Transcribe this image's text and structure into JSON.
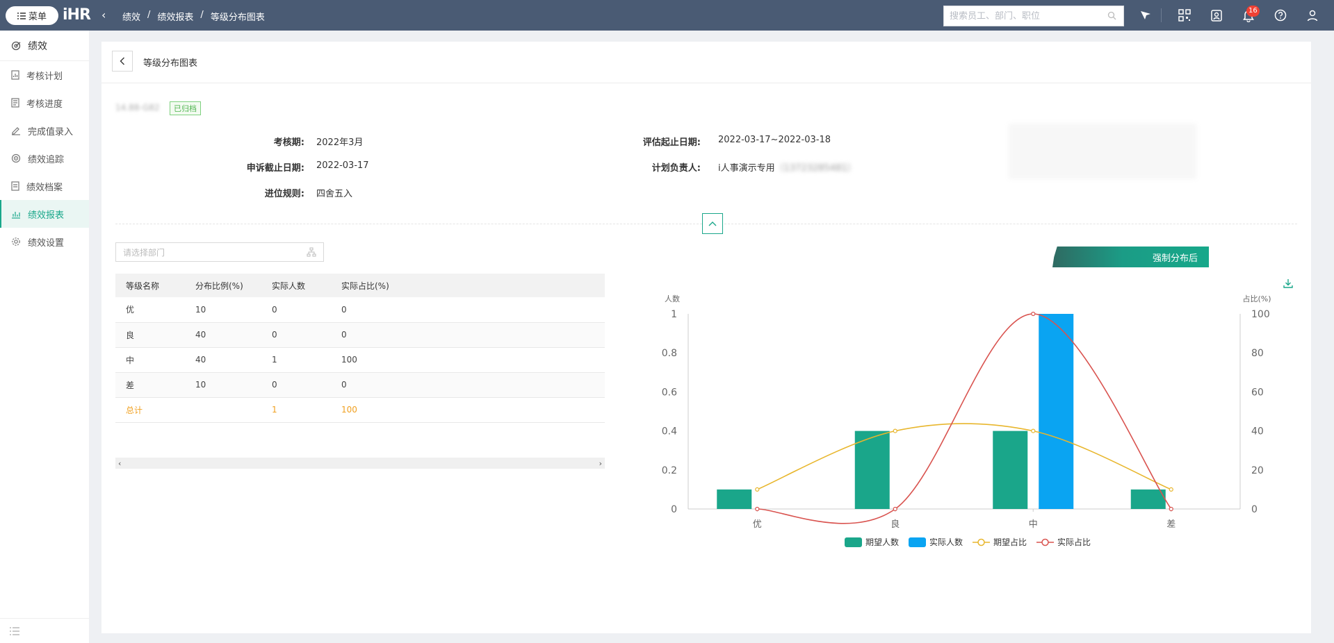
{
  "topbar": {
    "menu_label": "菜单",
    "logo_text": "iHR",
    "breadcrumb": [
      "绩效",
      "/",
      "绩效报表",
      "/",
      "等级分布图表"
    ],
    "search_placeholder": "搜索员工、部门、职位",
    "notification_count": "16"
  },
  "sidebar": {
    "title": "绩效",
    "items": [
      {
        "label": "考核计划",
        "icon": "doc-icon"
      },
      {
        "label": "考核进度",
        "icon": "progress-icon"
      },
      {
        "label": "完成值录入",
        "icon": "pen-icon"
      },
      {
        "label": "绩效追踪",
        "icon": "target-icon"
      },
      {
        "label": "绩效档案",
        "icon": "archive-icon"
      },
      {
        "label": "绩效报表",
        "icon": "chart-icon",
        "active": true
      },
      {
        "label": "绩效设置",
        "icon": "gear-icon"
      }
    ]
  },
  "page": {
    "title": "等级分布图表",
    "plan_name": "14.88-G82",
    "status_tag": "已归档",
    "fields": {
      "period_label": "考核期:",
      "period_value": "2022年3月",
      "appeal_label": "申诉截止日期:",
      "appeal_value": "2022-03-17",
      "rounding_label": "进位规则:",
      "rounding_value": "四舍五入",
      "eval_label": "评估起止日期:",
      "eval_value": "2022-03-17~2022-03-18",
      "owner_label": "计划负责人:",
      "owner_value": "i人事演示专用",
      "owner_suffix": "（13723285481）"
    },
    "dept_placeholder": "请选择部门",
    "force_btn_label": "强制分布后"
  },
  "table": {
    "headers": [
      "等级名称",
      "分布比例(%)",
      "实际人数",
      "实际占比(%)"
    ],
    "rows": [
      [
        "优",
        "10",
        "0",
        "0"
      ],
      [
        "良",
        "40",
        "0",
        "0"
      ],
      [
        "中",
        "40",
        "1",
        "100"
      ],
      [
        "差",
        "10",
        "0",
        "0"
      ]
    ],
    "total": [
      "总计",
      "",
      "1",
      "100"
    ]
  },
  "chart_data": {
    "type": "bar",
    "categories": [
      "优",
      "良",
      "中",
      "差"
    ],
    "ylabel_left": "人数",
    "ylabel_right": "占比(%)",
    "ylim_left": [
      0,
      1
    ],
    "yticks_left": [
      "0",
      "0.2",
      "0.4",
      "0.6",
      "0.8",
      "1"
    ],
    "ylim_right": [
      0,
      100
    ],
    "yticks_right": [
      "0",
      "20",
      "40",
      "60",
      "80",
      "100"
    ],
    "series": [
      {
        "name": "期望人数",
        "type": "bar",
        "axis": "left",
        "values": [
          0.1,
          0.4,
          0.4,
          0.1
        ],
        "color": "#1aa68a"
      },
      {
        "name": "实际人数",
        "type": "bar",
        "axis": "left",
        "values": [
          0,
          0,
          1,
          0
        ],
        "color": "#0aa4f2"
      },
      {
        "name": "期望占比",
        "type": "line",
        "axis": "right",
        "values": [
          10,
          40,
          40,
          10
        ],
        "color": "#e8b62c"
      },
      {
        "name": "实际占比",
        "type": "line",
        "axis": "right",
        "values": [
          0,
          0,
          100,
          0
        ],
        "color": "#d9534f"
      }
    ],
    "legend_position": "bottom-center",
    "grid": false
  },
  "colors": {
    "accent": "#19a78a",
    "topbar": "#4a5b74",
    "total_text": "#f0a020"
  }
}
